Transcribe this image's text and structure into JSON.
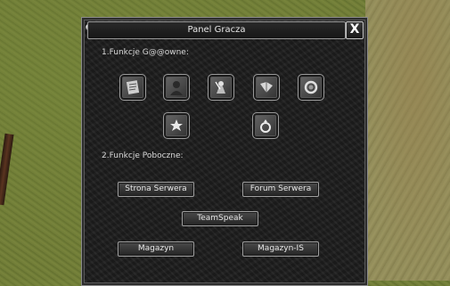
{
  "window": {
    "title": "Panel Gracza",
    "close_label": "X"
  },
  "sections": {
    "main_label": "1.Funkcje G@@owne:",
    "side_label": "2.Funkcje Poboczne:"
  },
  "icons": [
    {
      "name": "scroll-icon"
    },
    {
      "name": "silhouette-icon"
    },
    {
      "name": "warrior-icon"
    },
    {
      "name": "book-icon"
    },
    {
      "name": "ring-swirl-icon"
    },
    {
      "name": "emblem-icon"
    },
    {
      "name": "ring-icon"
    }
  ],
  "buttons": {
    "server_page": "Strona Serwera",
    "server_forum": "Forum Serwera",
    "teamspeak": "TeamSpeak",
    "storage": "Magazyn",
    "storage_is": "Magazyn-IS"
  }
}
